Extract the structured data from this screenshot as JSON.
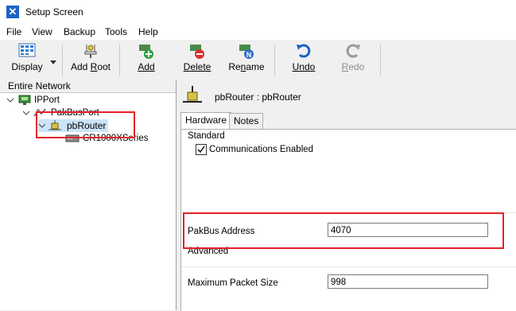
{
  "window": {
    "title": "Setup Screen"
  },
  "menu": [
    "File",
    "View",
    "Backup",
    "Tools",
    "Help"
  ],
  "toolbar": {
    "display": "Display",
    "add_root": "Add Root",
    "add": "Add",
    "delete": "Delete",
    "rename": "Rename",
    "undo": "Undo",
    "redo": "Redo"
  },
  "tree": {
    "header": "Entire Network",
    "nodes": [
      "IPPort",
      "PakBusPort",
      "pbRouter",
      "CR1000XSeries"
    ]
  },
  "device": {
    "title": "pbRouter : pbRouter"
  },
  "tabs": [
    "Hardware",
    "Notes"
  ],
  "hardware": {
    "standard_label": "Standard",
    "communications_enabled_label": "Communications Enabled",
    "communications_enabled": true,
    "pakbus_address_label": "PakBus Address",
    "pakbus_address": "4070",
    "advanced_label": "Advanced",
    "max_packet_size_label": "Maximum Packet Size",
    "max_packet_size": "998"
  },
  "colors": {
    "highlight": "#e3202a",
    "accent": "#1b63c6"
  }
}
